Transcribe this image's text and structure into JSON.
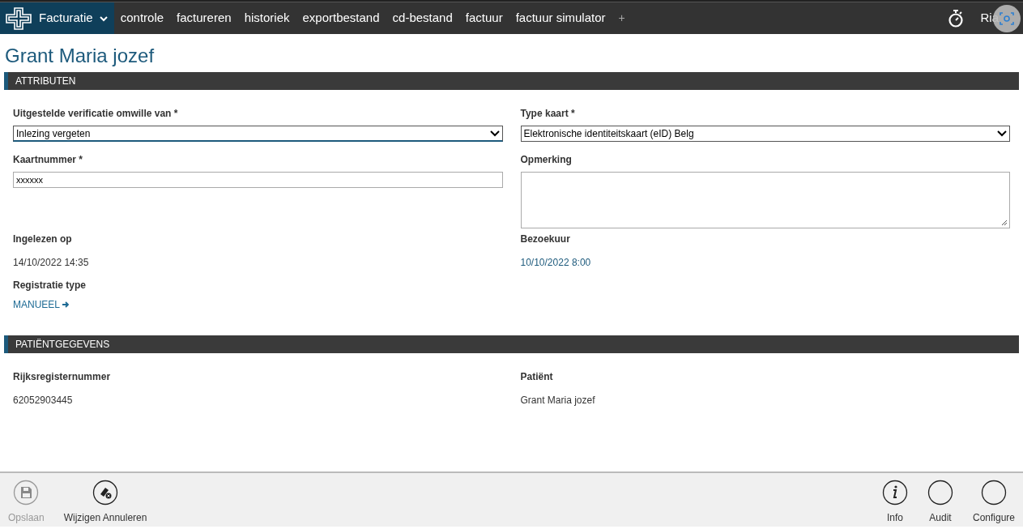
{
  "nav": {
    "app_menu": "Facturatie",
    "items": [
      "controle",
      "factureren",
      "historiek",
      "exportbestand",
      "cd-bestand",
      "factuur",
      "factuur simulator"
    ],
    "add": "+",
    "user": "Ria"
  },
  "title": "Grant Maria jozef",
  "sections": [
    {
      "heading": "ATTRIBUTEN",
      "fields": [
        {
          "kind": "select",
          "label": "Uitgestelde verificatie omwille van *",
          "value": "Inlezing vergeten",
          "focused": true
        },
        {
          "kind": "select",
          "label": "Type kaart *",
          "value": "Elektronische identiteitskaart (eID) Belg",
          "focused": false
        },
        {
          "kind": "input",
          "label": "Kaartnummer *",
          "value": "xxxxxx"
        },
        {
          "kind": "textarea",
          "label": "Opmerking"
        },
        {
          "kind": "text",
          "label": "Ingelezen op",
          "value": "14/10/2022 14:35"
        },
        {
          "kind": "date",
          "label": "Bezoekuur",
          "value": "10/10/2022 8:00"
        },
        {
          "kind": "link",
          "label": "Registratie type",
          "value": "MANUEEL"
        }
      ]
    },
    {
      "heading": "PATIËNTGEGEVENS",
      "fields": [
        {
          "kind": "text",
          "label": "Rijksregisternummer",
          "value": "62052903445"
        },
        {
          "kind": "text",
          "label": "Patiënt",
          "value": "Grant Maria jozef"
        }
      ]
    }
  ],
  "footer_left": [
    {
      "kind": "save",
      "label": "Opslaan",
      "disabled": true
    },
    {
      "kind": "cancel",
      "label": "Wijzigen Annuleren",
      "disabled": false
    }
  ],
  "footer_right": [
    {
      "kind": "info",
      "label": "Info",
      "disabled": false
    },
    {
      "kind": "blank",
      "label": "Audit",
      "disabled": false
    },
    {
      "kind": "blank",
      "label": "Configure",
      "disabled": false
    }
  ]
}
